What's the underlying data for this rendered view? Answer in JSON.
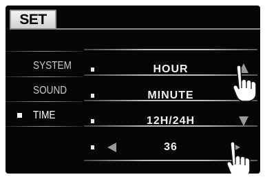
{
  "tab": {
    "label": "SET"
  },
  "sidebar": {
    "items": [
      {
        "label": "SYSTEM",
        "active": false
      },
      {
        "label": "SOUND",
        "active": false
      },
      {
        "label": "TIME",
        "active": true
      }
    ]
  },
  "rows": [
    {
      "value": "HOUR"
    },
    {
      "value": "MINUTE"
    },
    {
      "value": "12H/24H"
    },
    {
      "value": "36"
    }
  ],
  "colors": {
    "panel": "#050505",
    "text": "#f2f2f2",
    "arrow": "#9a9a9a",
    "tab": "#e6e6e6"
  },
  "icons": [
    "up-arrow-icon",
    "down-arrow-icon",
    "left-arrow-icon",
    "right-arrow-icon",
    "pointing-hand-icon"
  ]
}
